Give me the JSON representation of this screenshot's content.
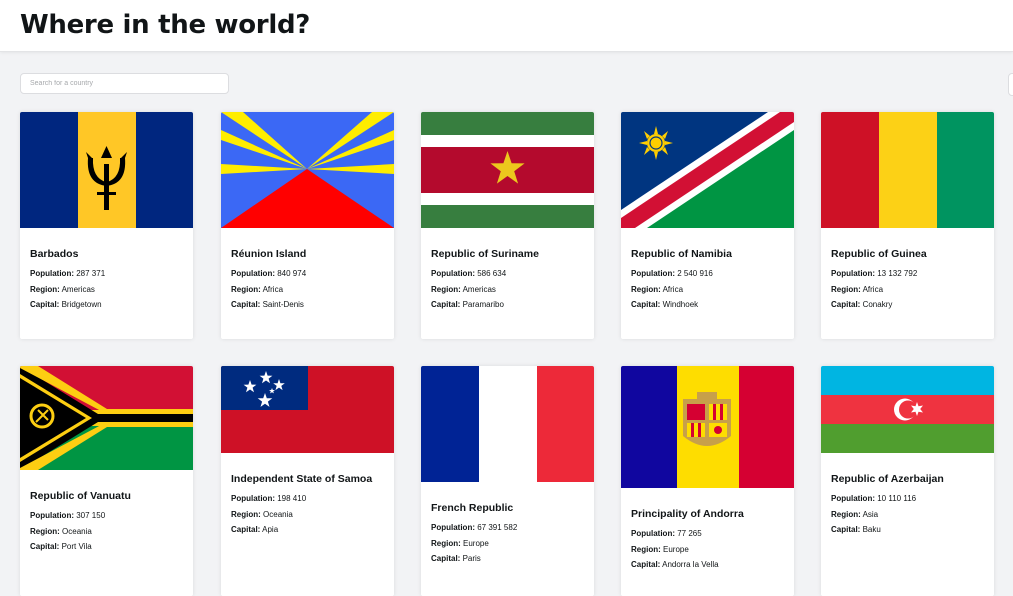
{
  "header": {
    "title": "Where in the world?"
  },
  "search": {
    "placeholder": "Search for a country"
  },
  "labels": {
    "population": "Population:",
    "region": "Region:",
    "capital": "Capital:"
  },
  "countries": [
    {
      "name": "Barbados",
      "population": "287 371",
      "region": "Americas",
      "capital": "Bridgetown",
      "flag": "barbados-flag"
    },
    {
      "name": "Réunion Island",
      "population": "840 974",
      "region": "Africa",
      "capital": "Saint-Denis",
      "flag": "reunion-flag"
    },
    {
      "name": "Republic of Suriname",
      "population": "586 634",
      "region": "Americas",
      "capital": "Paramaribo",
      "flag": "suriname-flag"
    },
    {
      "name": "Republic of Namibia",
      "population": "2 540 916",
      "region": "Africa",
      "capital": "Windhoek",
      "flag": "namibia-flag"
    },
    {
      "name": "Republic of Guinea",
      "population": "13 132 792",
      "region": "Africa",
      "capital": "Conakry",
      "flag": "guinea-flag"
    },
    {
      "name": "Republic of Vanuatu",
      "population": "307 150",
      "region": "Oceania",
      "capital": "Port Vila",
      "flag": "vanuatu-flag"
    },
    {
      "name": "Independent State of Samoa",
      "population": "198 410",
      "region": "Oceania",
      "capital": "Apia",
      "flag": "samoa-flag"
    },
    {
      "name": "French Republic",
      "population": "67 391 582",
      "region": "Europe",
      "capital": "Paris",
      "flag": "france-flag"
    },
    {
      "name": "Principality of Andorra",
      "population": "77 265",
      "region": "Europe",
      "capital": "Andorra la Vella",
      "flag": "andorra-flag"
    },
    {
      "name": "Republic of Azerbaijan",
      "population": "10 110 116",
      "region": "Asia",
      "capital": "Baku",
      "flag": "azerbaijan-flag"
    }
  ]
}
